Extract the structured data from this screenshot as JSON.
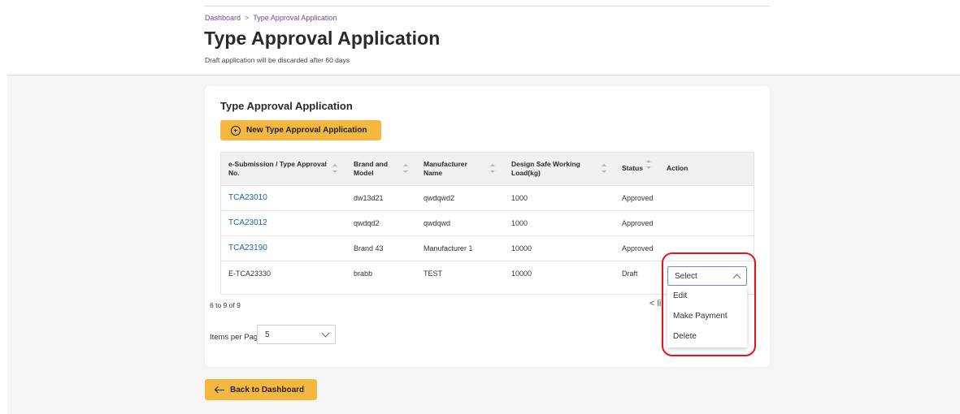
{
  "breadcrumb": {
    "home": "Dashboard",
    "separator": ">",
    "current": "Type Approval Application"
  },
  "page": {
    "title": "Type Approval Application",
    "subtitle": "Draft application will be discarded after 60 days"
  },
  "card": {
    "title": "Type Approval Application",
    "new_button": "New Type Approval Application"
  },
  "table": {
    "headers": {
      "no_line1": "e-Submission / Type Approval",
      "no_line2": "No.",
      "brand_line1": "Brand and",
      "brand_line2": "Model",
      "mfr_line1": "Manufacturer",
      "mfr_line2": "Name",
      "load_line1": "Design Safe Working",
      "load_line2": "Load(kg)",
      "status": "Status",
      "action": "Action"
    },
    "rows": [
      {
        "no": "TCA23010",
        "brand": "dw13d21",
        "manufacturer": "qwdqwd2",
        "load": "1000",
        "status": "Approved"
      },
      {
        "no": "TCA23012",
        "brand": "qwdqd2",
        "manufacturer": "qwdqwd",
        "load": "1000",
        "status": "Approved"
      },
      {
        "no": "TCA23190",
        "brand": "Brand 43",
        "manufacturer": "Manufacturer 1",
        "load": "10000",
        "status": "Approved"
      },
      {
        "no": "E-TCA23330",
        "brand": "brabb",
        "manufacturer": "TEST",
        "load": "10000",
        "status": "Draft"
      }
    ]
  },
  "pagination": {
    "info": "6 to 9 of 9",
    "items_per_page_label": "Items per Page:",
    "items_per_page": "5",
    "prev_fragment": "<  li"
  },
  "action_dropdown": {
    "selected": "Select",
    "options": [
      "Edit",
      "Make Payment",
      "Delete"
    ]
  },
  "back_button": "Back to Dashboard",
  "colors": {
    "accent_yellow": "#f4b740",
    "link_blue": "#1f5fa8",
    "breadcrumb_purple": "#6a4c93",
    "highlight_red": "#e8121b"
  }
}
